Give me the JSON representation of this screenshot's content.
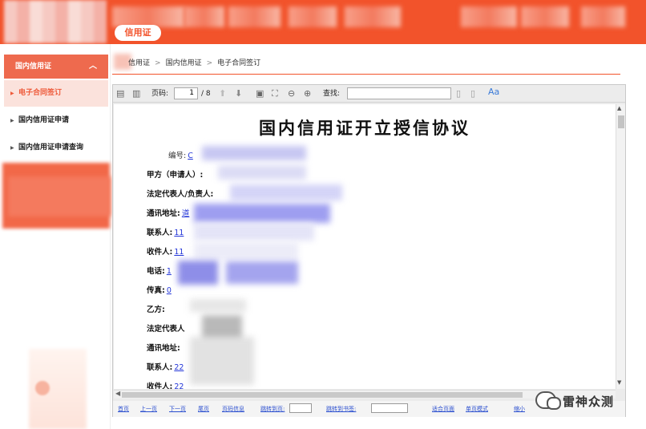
{
  "header": {
    "active_tab": "信用证"
  },
  "sidebar": {
    "group_label": "国内信用证",
    "items": [
      {
        "label": "电子合同签订",
        "active": true
      },
      {
        "label": "国内信用证申请",
        "active": false
      },
      {
        "label": "国内信用证申请查询",
        "active": false
      }
    ]
  },
  "breadcrumb": [
    "信用证",
    "国内信用证",
    "电子合同签订"
  ],
  "pdf_toolbar": {
    "page_label": "页码:",
    "page_value": "1",
    "page_total": "/ 8",
    "find_label": "查找:",
    "font_label": "Aa"
  },
  "document": {
    "title": "国内信用证开立授信协议",
    "fields": [
      {
        "label": "编号:",
        "value": "C"
      },
      {
        "label": "甲方（申请人）:",
        "value": ""
      },
      {
        "label": "法定代表人/负责人:",
        "value": ""
      },
      {
        "label": "通讯地址:",
        "value": "道"
      },
      {
        "label": "联系人:",
        "value": "11"
      },
      {
        "label": "收件人:",
        "value": "11"
      },
      {
        "label": "电话:",
        "value": "1"
      },
      {
        "label": "传真:",
        "value": "0"
      },
      {
        "label": "乙方:",
        "value": ""
      },
      {
        "label": "法定代表人",
        "value": ""
      },
      {
        "label": "通讯地址:",
        "value": ""
      },
      {
        "label": "联系人:",
        "value": "22"
      },
      {
        "label": "收件人:",
        "value": "22"
      }
    ]
  },
  "pager": {
    "first": "首页",
    "prev": "上一页",
    "next": "下一页",
    "last": "尾页",
    "page_info": "页码信息",
    "goto_page": "跳转到页:",
    "goto_bookmark": "跳转到书签:",
    "fit_page": "适合页面",
    "single_page": "单页模式",
    "zoom_out": "缩小"
  },
  "watermark": {
    "text": "雷神众测"
  },
  "colors": {
    "brand": "#f2532b",
    "link": "#2336d8"
  }
}
